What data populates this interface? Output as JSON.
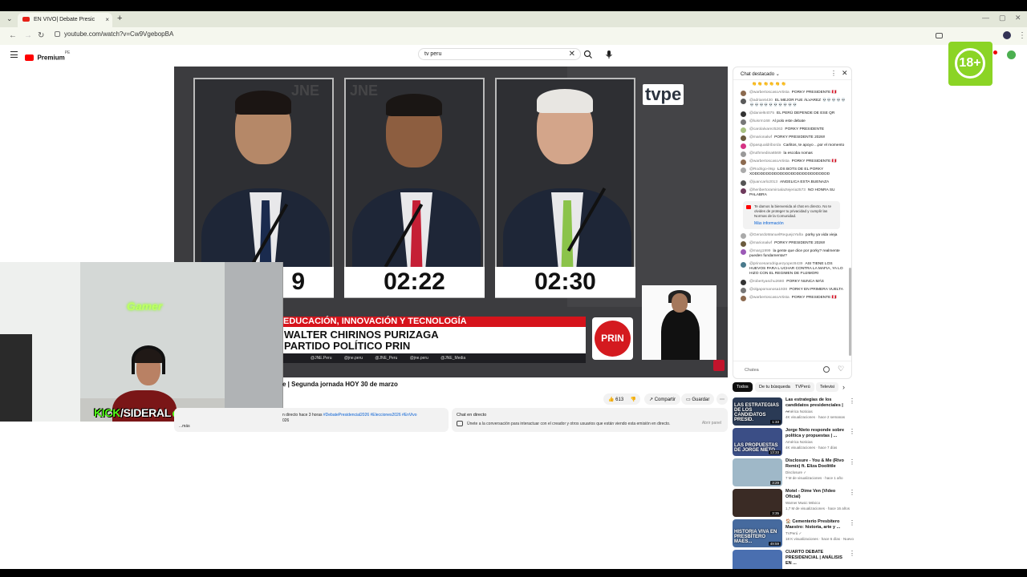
{
  "browser": {
    "tab_title": "EN VIVO| Debate Presic",
    "url": "youtube.com/watch?v=Cw9VgebopBA",
    "new_tab": "+",
    "close": "×"
  },
  "header": {
    "logo_text": "Premium",
    "logo_sup": "PE",
    "search_value": "tv peru",
    "age_badge": "18+"
  },
  "video": {
    "timers": [
      "9",
      "02:22",
      "02:30"
    ],
    "channel_logo": "tvpe",
    "jne_watermark": "JNE",
    "topic": "EDUCACIÓN, INNOVACIÓN Y TECNOLOGÍA",
    "name_line1": "WALTER CHIRINOS PURIZAGA",
    "name_line2": "PARTIDO POLÍTICO PRIN",
    "social": [
      "@JNE.Peru",
      "@jne.peru",
      "@JNE_Peru",
      "@jne.peru",
      "@JNE_Media"
    ],
    "party_logo": "PRIN",
    "title": "e | Segunda jornada HOY 30 de marzo",
    "likes": "613",
    "share_label": "Compartir",
    "save_label": "Guardar",
    "desc_line1_prefix": "n directo hace 3 horas ",
    "desc_tags": "#DebatePresidencial2026 #Elecciones2026 #EnVivo",
    "desc_line2": "026 ",
    "desc_more": "...más",
    "live_chat_title": "Chat en directo",
    "live_chat_text": "Únete a la conversación para interactuar con el creador y otros usuarios que están viendo esta emisión en directo.",
    "live_chat_btn": "Abrir panel"
  },
  "stream_overlay": {
    "neon_sign": "Gamer",
    "kick_label_prefix": "KICK",
    "kick_label_suffix": "/SIDERAL"
  },
  "chat": {
    "title": "Chat destacado",
    "input_placeholder": "Chatea",
    "messages": [
      {
        "author": "",
        "text": "👏 👏 👏 👏 👏 👏",
        "color": "#ffffff"
      },
      {
        "author": "@warbertoscasoArtista",
        "text": "PORKY PRESIDENTE 🇵🇪",
        "color": "#8c6a4f"
      },
      {
        "author": "@adrian6430",
        "text": "EL MEJOR FUE ÁLVAREZ 💀💀💀💀💀💀💀💀💀💀💀💀💀💀💀",
        "color": "#5a5a5a"
      },
      {
        "author": "@daniel64075",
        "text": "EL PERÚ DEPENDE DE ESE QR",
        "color": "#333333"
      },
      {
        "author": "@luisrm168",
        "text": "Al polo este debate",
        "color": "#777777"
      },
      {
        "author": "@carolalvarez5263",
        "text": "PORKY PRESIDENTE",
        "color": "#a8c080"
      },
      {
        "author": "@marionalwf",
        "text": "PORKY PRESIDENTE 2026!!",
        "color": "#6b5b3e"
      },
      {
        "author": "@pasqualdriborda",
        "text": "Carlitos, te apoyo ...por el momento",
        "color": "#d63384"
      },
      {
        "author": "@ruthmedina6569",
        "text": "la escoba nomas",
        "color": "#999999"
      },
      {
        "author": "@warbertoscasoArtista",
        "text": "PORKY PRESIDENTE 🇵🇪",
        "color": "#8c6a4f"
      },
      {
        "author": "@Rodrigo-i9sp",
        "text": "LOS BOTS DE EL PORKY XDDDDDDDDDDDDDDDDDDDDDDDDDDDD",
        "color": "#aaaaaa"
      },
      {
        "author": "@juancarlo2013",
        "text": "ANGELICA ESTA BUENAZA",
        "color": "#555555"
      },
      {
        "author": "@heribertoramiroalaztejeria2573",
        "text": "NO HONRA SU PALABRA",
        "color": "#6e3a5c"
      }
    ],
    "welcome": "Te damos la bienvenida al chat en directo. No te olvides de proteger tu privacidad y cumplir las Normas de la Comunidad.",
    "welcome_more": "Más información",
    "messages2": [
      {
        "author": "@GerardoManuelRequejoYaña",
        "text": "porky ya vida vieja",
        "color": "#aaaaaa"
      },
      {
        "author": "@marionalwf",
        "text": "PORKY PRESIDENTE 2026!!",
        "color": "#6b5b3e"
      },
      {
        "author": "@marg1999",
        "text": "la gente que dice por porky? realmente pueden fundamentar?",
        "color": "#9b59b6"
      },
      {
        "author": "@princesarodriguezyopez8439",
        "text": "ASI TIENE LOS HUEVOS PARA L UCHAR CONTRA LA MAFIA, YA LO HIZO CON EL REGIMEN DE FUJIMORI",
        "color": "#4a7a8c"
      },
      {
        "author": "@robertyaschu2680",
        "text": "PORKY NUNCA MÁS",
        "color": "#333333"
      },
      {
        "author": "@olgapomanosa1938",
        "text": "PORKY EN PRIMERA VUELTA",
        "color": "#777777"
      },
      {
        "author": "@warbertoscasoArtista",
        "text": "PORKY PRESIDENTE 🇵🇪",
        "color": "#8c6a4f"
      }
    ]
  },
  "chips": [
    "Todos",
    "De tu búsqueda",
    "TVPerú",
    "Televisi"
  ],
  "recommendations": [
    {
      "title": "Las estrategias de los candidatos presidenciales | ...",
      "channel": "América Noticias",
      "meta": "4K visualizaciones · hace 2 semanas",
      "duration": "1:33",
      "thumb_label": "LAS ESTRATEGIAS DE LOS CANDIDATOS PRESID.",
      "color": "#2a3a55"
    },
    {
      "title": "Jorge Nieto responde sobre política y propuestas | ...",
      "channel": "América Noticias",
      "meta": "4K visualizaciones · hace 7 días",
      "duration": "13:33",
      "thumb_label": "LAS PROPUESTAS DE JORGE NIETO",
      "color": "#3b4e86"
    },
    {
      "title": "Disclosure - You & Me (Rivo Remix) ft. Eliza Doolittle",
      "channel": "Disclosure ✓",
      "meta": "7 M de visualizaciones · hace 1 año",
      "duration": "3:29",
      "thumb_label": "",
      "color": "#9fb8c8"
    },
    {
      "title": "Motel - Dime Ven (Video Oficial)",
      "channel": "Warner Music México",
      "meta": "1,7 M de visualizaciones · hace 16 años",
      "duration": "3:35",
      "thumb_label": "",
      "color": "#3a2b25"
    },
    {
      "title": "🏠 Cementerio Presbítero Maestro: historia, arte y ...",
      "channel": "TVPerú ✓",
      "meta": "18 K visualizaciones · hace 6 días · Nuevo",
      "duration": "49:59",
      "thumb_label": "HISTORIA VIVA EN PRESBÍTERO MAES...",
      "color": "#466a9e"
    },
    {
      "title": "CUARTO DEBATE PRESIDENCIAL | ANÁLISIS EN ...",
      "channel": "",
      "meta": "",
      "duration": "",
      "thumb_label": "",
      "color": "#4a6fb0"
    }
  ]
}
